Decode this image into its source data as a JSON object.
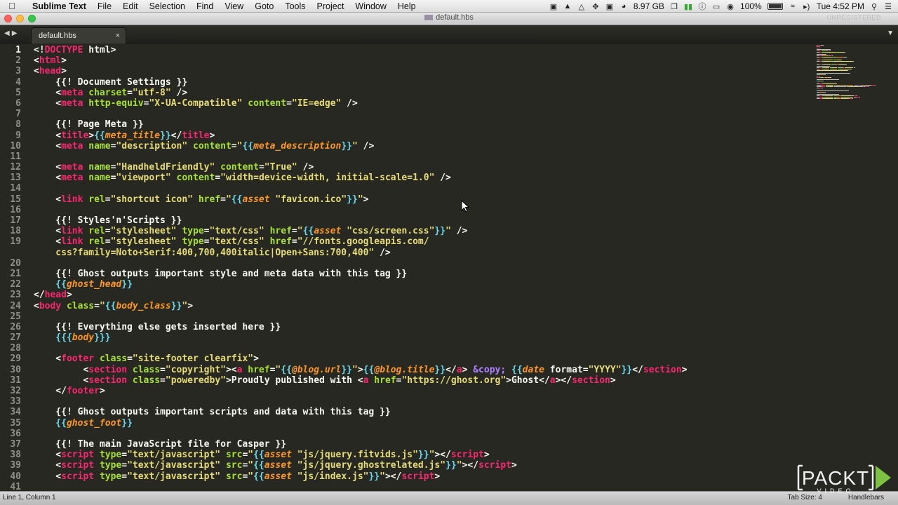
{
  "menubar": {
    "app_name": "Sublime Text",
    "items": [
      "File",
      "Edit",
      "Selection",
      "Find",
      "View",
      "Goto",
      "Tools",
      "Project",
      "Window",
      "Help"
    ],
    "status": {
      "memory": "8.97 GB",
      "battery": "100%",
      "battery_level": 1.0,
      "clock": "Tue 4:52 PM"
    }
  },
  "window": {
    "title": "default.hbs",
    "unregistered": "UNREGISTERED"
  },
  "tabs": [
    {
      "label": "default.hbs",
      "close": "×"
    }
  ],
  "editor": {
    "line_numbers": [
      "1",
      "2",
      "3",
      "4",
      "5",
      "6",
      "7",
      "8",
      "9",
      "10",
      "11",
      "12",
      "13",
      "14",
      "15",
      "16",
      "17",
      "18",
      "19",
      "",
      "20",
      "21",
      "22",
      "23",
      "24",
      "25",
      "26",
      "27",
      "28",
      "29",
      "30",
      "31",
      "32",
      "33",
      "34",
      "35",
      "36",
      "37",
      "38",
      "39",
      "40",
      "41"
    ],
    "current_line": "1",
    "lines": [
      [
        [
          "p",
          "<!"
        ],
        [
          "t",
          "DOCTYPE"
        ],
        [
          "p",
          " html>"
        ]
      ],
      [
        [
          "p",
          "<"
        ],
        [
          "t",
          "html"
        ],
        [
          "p",
          ">"
        ]
      ],
      [
        [
          "p",
          "<"
        ],
        [
          "t",
          "head"
        ],
        [
          "p",
          ">"
        ]
      ],
      [
        [
          "p",
          "    {{! Document Settings }}"
        ]
      ],
      [
        [
          "p",
          "    <"
        ],
        [
          "t",
          "meta"
        ],
        [
          "p",
          " "
        ],
        [
          "a",
          "charset"
        ],
        [
          "p",
          "="
        ],
        [
          "s",
          "\"utf-8\""
        ],
        [
          "p",
          " />"
        ]
      ],
      [
        [
          "p",
          "    <"
        ],
        [
          "t",
          "meta"
        ],
        [
          "p",
          " "
        ],
        [
          "a",
          "http-equiv"
        ],
        [
          "p",
          "="
        ],
        [
          "s",
          "\"X-UA-Compatible\""
        ],
        [
          "p",
          " "
        ],
        [
          "a",
          "content"
        ],
        [
          "p",
          "="
        ],
        [
          "s",
          "\"IE=edge\""
        ],
        [
          "p",
          " />"
        ]
      ],
      [],
      [
        [
          "p",
          "    {{! Page Meta }}"
        ]
      ],
      [
        [
          "p",
          "    <"
        ],
        [
          "t",
          "title"
        ],
        [
          "p",
          ">"
        ],
        [
          "h",
          "{{"
        ],
        [
          "hi",
          "meta_title"
        ],
        [
          "h",
          "}}"
        ],
        [
          "p",
          "</"
        ],
        [
          "t",
          "title"
        ],
        [
          "p",
          ">"
        ]
      ],
      [
        [
          "p",
          "    <"
        ],
        [
          "t",
          "meta"
        ],
        [
          "p",
          " "
        ],
        [
          "a",
          "name"
        ],
        [
          "p",
          "="
        ],
        [
          "s",
          "\"description\""
        ],
        [
          "p",
          " "
        ],
        [
          "a",
          "content"
        ],
        [
          "p",
          "="
        ],
        [
          "s",
          "\""
        ],
        [
          "h",
          "{{"
        ],
        [
          "hi",
          "meta_description"
        ],
        [
          "h",
          "}}"
        ],
        [
          "s",
          "\""
        ],
        [
          "p",
          " />"
        ]
      ],
      [],
      [
        [
          "p",
          "    <"
        ],
        [
          "t",
          "meta"
        ],
        [
          "p",
          " "
        ],
        [
          "a",
          "name"
        ],
        [
          "p",
          "="
        ],
        [
          "s",
          "\"HandheldFriendly\""
        ],
        [
          "p",
          " "
        ],
        [
          "a",
          "content"
        ],
        [
          "p",
          "="
        ],
        [
          "s",
          "\"True\""
        ],
        [
          "p",
          " />"
        ]
      ],
      [
        [
          "p",
          "    <"
        ],
        [
          "t",
          "meta"
        ],
        [
          "p",
          " "
        ],
        [
          "a",
          "name"
        ],
        [
          "p",
          "="
        ],
        [
          "s",
          "\"viewport\""
        ],
        [
          "p",
          " "
        ],
        [
          "a",
          "content"
        ],
        [
          "p",
          "="
        ],
        [
          "s",
          "\"width=device-width, initial-scale=1.0\""
        ],
        [
          "p",
          " />"
        ]
      ],
      [],
      [
        [
          "p",
          "    <"
        ],
        [
          "t",
          "link"
        ],
        [
          "p",
          " "
        ],
        [
          "a",
          "rel"
        ],
        [
          "p",
          "="
        ],
        [
          "s",
          "\"shortcut icon\""
        ],
        [
          "p",
          " "
        ],
        [
          "a",
          "href"
        ],
        [
          "p",
          "="
        ],
        [
          "s",
          "\""
        ],
        [
          "h",
          "{{"
        ],
        [
          "hi",
          "asset"
        ],
        [
          "p",
          " "
        ],
        [
          "s",
          "\"favicon.ico\""
        ],
        [
          "h",
          "}}"
        ],
        [
          "s",
          "\""
        ],
        [
          "p",
          ">"
        ]
      ],
      [],
      [
        [
          "p",
          "    {{! Styles'n'Scripts }}"
        ]
      ],
      [
        [
          "p",
          "    <"
        ],
        [
          "t",
          "link"
        ],
        [
          "p",
          " "
        ],
        [
          "a",
          "rel"
        ],
        [
          "p",
          "="
        ],
        [
          "s",
          "\"stylesheet\""
        ],
        [
          "p",
          " "
        ],
        [
          "a",
          "type"
        ],
        [
          "p",
          "="
        ],
        [
          "s",
          "\"text/css\""
        ],
        [
          "p",
          " "
        ],
        [
          "a",
          "href"
        ],
        [
          "p",
          "="
        ],
        [
          "s",
          "\""
        ],
        [
          "h",
          "{{"
        ],
        [
          "hi",
          "asset"
        ],
        [
          "p",
          " "
        ],
        [
          "s",
          "\"css/screen.css\""
        ],
        [
          "h",
          "}}"
        ],
        [
          "s",
          "\""
        ],
        [
          "p",
          " />"
        ]
      ],
      [
        [
          "p",
          "    <"
        ],
        [
          "t",
          "link"
        ],
        [
          "p",
          " "
        ],
        [
          "a",
          "rel"
        ],
        [
          "p",
          "="
        ],
        [
          "s",
          "\"stylesheet\""
        ],
        [
          "p",
          " "
        ],
        [
          "a",
          "type"
        ],
        [
          "p",
          "="
        ],
        [
          "s",
          "\"text/css\""
        ],
        [
          "p",
          " "
        ],
        [
          "a",
          "href"
        ],
        [
          "p",
          "="
        ],
        [
          "s",
          "\"//fonts.googleapis.com/"
        ]
      ],
      [
        [
          "s",
          "    css?family=Noto+Serif:400,700,400italic|Open+Sans:700,400\""
        ],
        [
          "p",
          " />"
        ]
      ],
      [],
      [
        [
          "p",
          "    {{! Ghost outputs important style and meta data with this tag }}"
        ]
      ],
      [
        [
          "h",
          "    {{"
        ],
        [
          "hi",
          "ghost_head"
        ],
        [
          "h",
          "}}"
        ]
      ],
      [
        [
          "p",
          "</"
        ],
        [
          "t",
          "head"
        ],
        [
          "p",
          ">"
        ]
      ],
      [
        [
          "p",
          "<"
        ],
        [
          "t",
          "body"
        ],
        [
          "p",
          " "
        ],
        [
          "a",
          "class"
        ],
        [
          "p",
          "="
        ],
        [
          "s",
          "\""
        ],
        [
          "h",
          "{{"
        ],
        [
          "hi",
          "body_class"
        ],
        [
          "h",
          "}}"
        ],
        [
          "s",
          "\""
        ],
        [
          "p",
          ">"
        ]
      ],
      [],
      [
        [
          "p",
          "    {{! Everything else gets inserted here }}"
        ]
      ],
      [
        [
          "h",
          "    {{{"
        ],
        [
          "hi",
          "body"
        ],
        [
          "h",
          "}}}"
        ]
      ],
      [],
      [
        [
          "p",
          "    <"
        ],
        [
          "t",
          "footer"
        ],
        [
          "p",
          " "
        ],
        [
          "a",
          "class"
        ],
        [
          "p",
          "="
        ],
        [
          "s",
          "\"site-footer clearfix\""
        ],
        [
          "p",
          ">"
        ]
      ],
      [
        [
          "p",
          "         <"
        ],
        [
          "t",
          "section"
        ],
        [
          "p",
          " "
        ],
        [
          "a",
          "class"
        ],
        [
          "p",
          "="
        ],
        [
          "s",
          "\"copyright\""
        ],
        [
          "p",
          "><"
        ],
        [
          "t",
          "a"
        ],
        [
          "p",
          " "
        ],
        [
          "a",
          "href"
        ],
        [
          "p",
          "="
        ],
        [
          "s",
          "\""
        ],
        [
          "h",
          "{{"
        ],
        [
          "hi",
          "@blog.url"
        ],
        [
          "h",
          "}}"
        ],
        [
          "s",
          "\""
        ],
        [
          "p",
          ">"
        ],
        [
          "h",
          "{{"
        ],
        [
          "hi",
          "@blog.title"
        ],
        [
          "h",
          "}}"
        ],
        [
          "p",
          "</"
        ],
        [
          "t",
          "a"
        ],
        [
          "p",
          "> "
        ],
        [
          "e",
          "&copy;"
        ],
        [
          "p",
          " "
        ],
        [
          "h",
          "{{"
        ],
        [
          "hi",
          "date"
        ],
        [
          "p",
          " format="
        ],
        [
          "s",
          "\"YYYY\""
        ],
        [
          "h",
          "}}"
        ],
        [
          "p",
          "</"
        ],
        [
          "t",
          "section"
        ],
        [
          "p",
          ">"
        ]
      ],
      [
        [
          "p",
          "         <"
        ],
        [
          "t",
          "section"
        ],
        [
          "p",
          " "
        ],
        [
          "a",
          "class"
        ],
        [
          "p",
          "="
        ],
        [
          "s",
          "\"poweredby\""
        ],
        [
          "p",
          ">Proudly published with <"
        ],
        [
          "t",
          "a"
        ],
        [
          "p",
          " "
        ],
        [
          "a",
          "href"
        ],
        [
          "p",
          "="
        ],
        [
          "s",
          "\"https://ghost.org\""
        ],
        [
          "p",
          ">Ghost</"
        ],
        [
          "t",
          "a"
        ],
        [
          "p",
          "></"
        ],
        [
          "t",
          "section"
        ],
        [
          "p",
          ">"
        ]
      ],
      [
        [
          "p",
          "    </"
        ],
        [
          "t",
          "footer"
        ],
        [
          "p",
          ">"
        ]
      ],
      [],
      [
        [
          "p",
          "    {{! Ghost outputs important scripts and data with this tag }}"
        ]
      ],
      [
        [
          "h",
          "    {{"
        ],
        [
          "hi",
          "ghost_foot"
        ],
        [
          "h",
          "}}"
        ]
      ],
      [],
      [
        [
          "p",
          "    {{! The main JavaScript file for Casper }}"
        ]
      ],
      [
        [
          "p",
          "    <"
        ],
        [
          "t",
          "script"
        ],
        [
          "p",
          " "
        ],
        [
          "a",
          "type"
        ],
        [
          "p",
          "="
        ],
        [
          "s",
          "\"text/javascript\""
        ],
        [
          "p",
          " "
        ],
        [
          "a",
          "src"
        ],
        [
          "p",
          "="
        ],
        [
          "s",
          "\""
        ],
        [
          "h",
          "{{"
        ],
        [
          "hi",
          "asset"
        ],
        [
          "p",
          " "
        ],
        [
          "s",
          "\"js/jquery.fitvids.js\""
        ],
        [
          "h",
          "}}"
        ],
        [
          "s",
          "\""
        ],
        [
          "p",
          "></"
        ],
        [
          "t",
          "script"
        ],
        [
          "p",
          ">"
        ]
      ],
      [
        [
          "p",
          "    <"
        ],
        [
          "t",
          "script"
        ],
        [
          "p",
          " "
        ],
        [
          "a",
          "type"
        ],
        [
          "p",
          "="
        ],
        [
          "s",
          "\"text/javascript\""
        ],
        [
          "p",
          " "
        ],
        [
          "a",
          "src"
        ],
        [
          "p",
          "="
        ],
        [
          "s",
          "\""
        ],
        [
          "h",
          "{{"
        ],
        [
          "hi",
          "asset"
        ],
        [
          "p",
          " "
        ],
        [
          "s",
          "\"js/jquery.ghostrelated.js\""
        ],
        [
          "h",
          "}}"
        ],
        [
          "s",
          "\""
        ],
        [
          "p",
          "></"
        ],
        [
          "t",
          "script"
        ],
        [
          "p",
          ">"
        ]
      ],
      [
        [
          "p",
          "    <"
        ],
        [
          "t",
          "script"
        ],
        [
          "p",
          " "
        ],
        [
          "a",
          "type"
        ],
        [
          "p",
          "="
        ],
        [
          "s",
          "\"text/javascript\""
        ],
        [
          "p",
          " "
        ],
        [
          "a",
          "src"
        ],
        [
          "p",
          "="
        ],
        [
          "s",
          "\""
        ],
        [
          "h",
          "{{"
        ],
        [
          "hi",
          "asset"
        ],
        [
          "p",
          " "
        ],
        [
          "s",
          "\"js/index.js\""
        ],
        [
          "h",
          "}}"
        ],
        [
          "s",
          "\""
        ],
        [
          "p",
          "></"
        ],
        [
          "t",
          "script"
        ],
        [
          "p",
          ">"
        ]
      ],
      []
    ]
  },
  "statusbar": {
    "position": "Line 1, Column 1",
    "tab_size": "Tab Size: 4",
    "syntax": "Handlebars"
  },
  "watermark": {
    "brand": "PACKT",
    "sub": "VIDEO"
  },
  "colors": {
    "editor_bg": "#272822",
    "tag": "#f92672",
    "attribute": "#a6e22e",
    "string": "#e6db74",
    "handlebars": "#66d9ef",
    "helper": "#fd971f",
    "entity": "#ae81ff",
    "watermark_green": "#7dc242"
  }
}
